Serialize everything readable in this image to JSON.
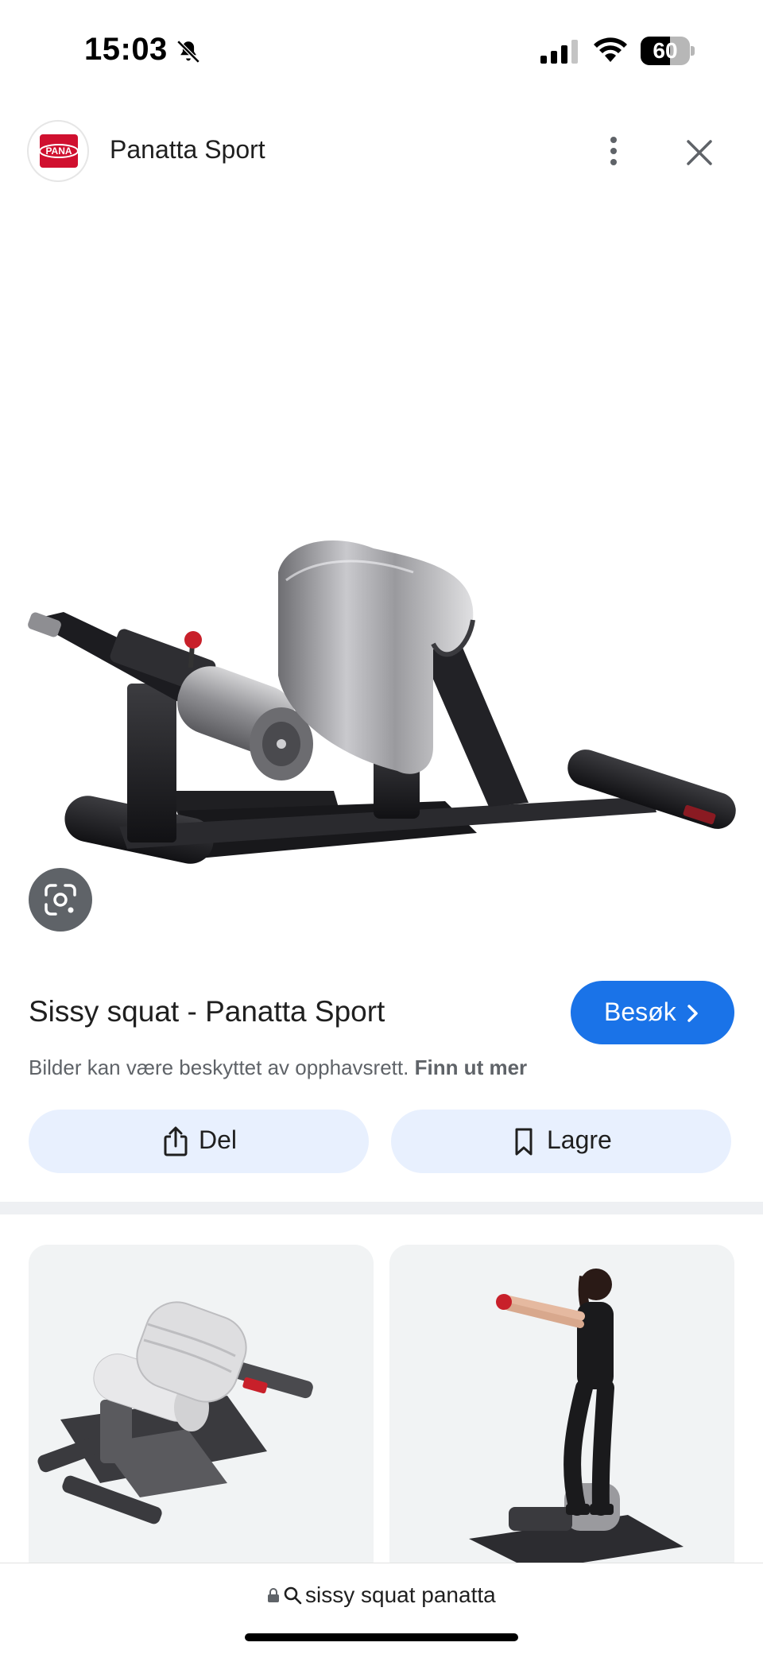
{
  "status_bar": {
    "time": "15:03",
    "battery": "60",
    "battery_level": 0.6,
    "icons": [
      "bell-off-icon",
      "cellular-signal-icon",
      "wifi-icon",
      "battery-icon"
    ]
  },
  "source": {
    "logo_text": "PANA",
    "name": "Panatta Sport",
    "icons": [
      "more-vert-icon",
      "close-icon"
    ]
  },
  "result": {
    "title": "Sissy squat - Panatta Sport",
    "visit_label": "Besøk",
    "copyright_text": "Bilder kan være beskyttet av opphavsrett.",
    "copyright_link": "Finn ut mer"
  },
  "actions": {
    "share_label": "Del",
    "save_label": "Lagre"
  },
  "url_bar": {
    "query": "sissy squat panatta"
  },
  "colors": {
    "accent": "#1a73e8",
    "chip_bg": "#e8f0fe",
    "brand_red": "#d0102f"
  }
}
